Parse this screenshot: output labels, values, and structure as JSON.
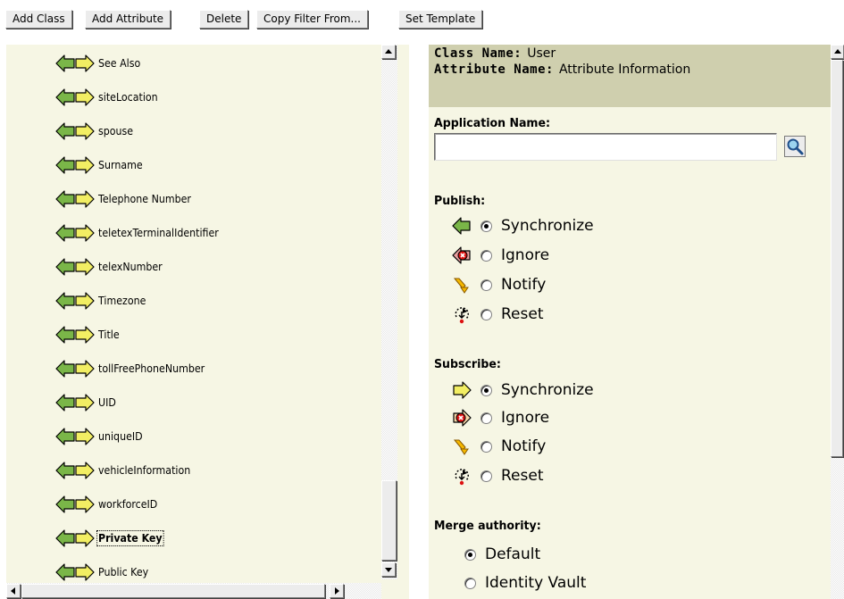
{
  "toolbar": {
    "add_class": "Add Class",
    "add_attribute": "Add Attribute",
    "delete": "Delete",
    "copy_filter_from": "Copy Filter From...",
    "set_template": "Set Template"
  },
  "tree": {
    "items": [
      {
        "label": "See Also"
      },
      {
        "label": "siteLocation"
      },
      {
        "label": "spouse"
      },
      {
        "label": "Surname"
      },
      {
        "label": "Telephone Number"
      },
      {
        "label": "teletexTerminalIdentifier"
      },
      {
        "label": "telexNumber"
      },
      {
        "label": "Timezone"
      },
      {
        "label": "Title"
      },
      {
        "label": "tollFreePhoneNumber"
      },
      {
        "label": "UID"
      },
      {
        "label": "uniqueID"
      },
      {
        "label": "vehicleInformation"
      },
      {
        "label": "workforceID"
      },
      {
        "label": "Private Key"
      },
      {
        "label": "Public Key"
      }
    ],
    "selected_label": "Private Key",
    "icon": "bidirectional-arrows-icon"
  },
  "details": {
    "class_name_label": "Class Name:",
    "class_name_value": "User",
    "attribute_name_label": "Attribute Name:",
    "attribute_name_value": "Attribute Information",
    "application_name_label": "Application Name:",
    "application_name_value": "",
    "publish": {
      "label": "Publish:",
      "options": [
        {
          "label": "Synchronize",
          "icon": "left-arrow-icon",
          "checked": true
        },
        {
          "label": "Ignore",
          "icon": "ignore-icon",
          "checked": false
        },
        {
          "label": "Notify",
          "icon": "notify-icon",
          "checked": false
        },
        {
          "label": "Reset",
          "icon": "reset-icon",
          "checked": false
        }
      ]
    },
    "subscribe": {
      "label": "Subscribe:",
      "options": [
        {
          "label": "Synchronize",
          "icon": "right-arrow-icon",
          "checked": true
        },
        {
          "label": "Ignore",
          "icon": "ignore-icon",
          "checked": false
        },
        {
          "label": "Notify",
          "icon": "notify-icon",
          "checked": false
        },
        {
          "label": "Reset",
          "icon": "reset-icon",
          "checked": false
        }
      ]
    },
    "merge_authority": {
      "label": "Merge authority:",
      "options": [
        {
          "label": "Default",
          "checked": true
        },
        {
          "label": "Identity Vault",
          "checked": false
        }
      ]
    }
  },
  "colors": {
    "panel_bg": "#f6f6e4",
    "header_bg": "#cfcfae",
    "arrow_green": "#7ab648",
    "arrow_yellow": "#f2ee63"
  }
}
